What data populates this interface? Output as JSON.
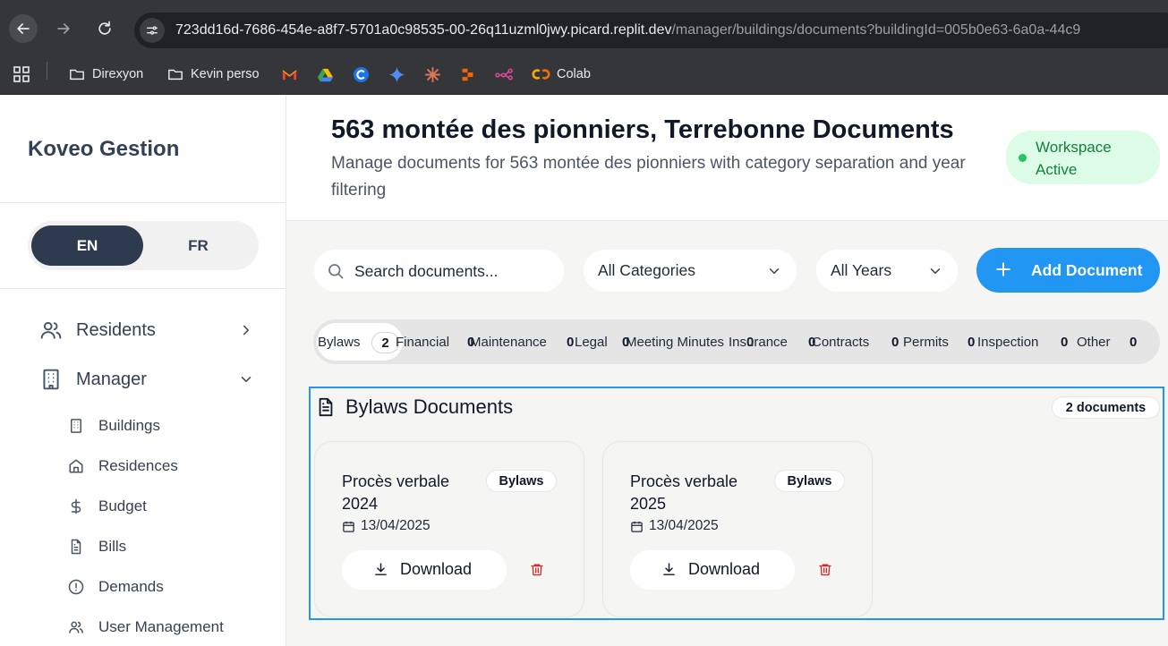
{
  "browser": {
    "url_main": "723dd16d-7686-454e-a8f7-5701a0c98535-00-26q11uzml0jwy.picard.replit.dev",
    "url_path": "/manager/buildings/documents?buildingId=005b0e63-6a0a-44c9",
    "bookmarks": [
      {
        "label": "Direxyon",
        "icon": "folder-icon"
      },
      {
        "label": "Kevin perso",
        "icon": "folder-icon"
      },
      {
        "label": "",
        "icon": "gmail-icon"
      },
      {
        "label": "",
        "icon": "drive-icon"
      },
      {
        "label": "",
        "icon": "c-icon"
      },
      {
        "label": "",
        "icon": "sparkle-icon"
      },
      {
        "label": "",
        "icon": "claude-icon"
      },
      {
        "label": "",
        "icon": "replit-icon"
      },
      {
        "label": "",
        "icon": "graph-icon"
      },
      {
        "label": "Colab",
        "icon": "colab-icon"
      }
    ]
  },
  "sidebar": {
    "brand": "Koveo Gestion",
    "lang": {
      "en": "EN",
      "fr": "FR",
      "active": "EN"
    },
    "menu": [
      {
        "label": "Residents",
        "icon": "users-icon",
        "expanded": false
      },
      {
        "label": "Manager",
        "icon": "building-icon",
        "expanded": true
      }
    ],
    "submenu": [
      {
        "label": "Buildings",
        "icon": "building-icon"
      },
      {
        "label": "Residences",
        "icon": "home-icon"
      },
      {
        "label": "Budget",
        "icon": "dollar-icon"
      },
      {
        "label": "Bills",
        "icon": "file-icon"
      },
      {
        "label": "Demands",
        "icon": "alert-circle-icon"
      },
      {
        "label": "User Management",
        "icon": "users-icon"
      }
    ]
  },
  "header": {
    "title": "563 montée des pionniers, Terrebonne Documents",
    "description": "Manage documents for 563 montée des pionniers with category separation and year filtering",
    "workspace_status": "Workspace Active",
    "status_color": "#22c55e"
  },
  "controls": {
    "search_placeholder": "Search documents...",
    "category_value": "All Categories",
    "year_value": "All Years",
    "add_button": "Add Document"
  },
  "tabs": [
    {
      "label": "Bylaws",
      "count": "2",
      "active": true
    },
    {
      "label": "Financial",
      "count": "0"
    },
    {
      "label": "Maintenance",
      "count": "0"
    },
    {
      "label": "Legal",
      "count": "0"
    },
    {
      "label": "Meeting Minutes",
      "count": "0"
    },
    {
      "label": "Insurance",
      "count": "0"
    },
    {
      "label": "Contracts",
      "count": "0"
    },
    {
      "label": "Permits",
      "count": "0"
    },
    {
      "label": "Inspection",
      "count": "0"
    },
    {
      "label": "Other",
      "count": "0"
    }
  ],
  "section": {
    "title": "Bylaws Documents",
    "count": "2 documents",
    "documents": [
      {
        "title": "Procès verbale 2024",
        "category": "Bylaws",
        "date": "13/04/2025",
        "download": "Download"
      },
      {
        "title": "Procès verbale 2025",
        "category": "Bylaws",
        "date": "13/04/2025",
        "download": "Download"
      }
    ]
  },
  "colors": {
    "accent": "#2196f3",
    "sidebar_active": "#2e3a4e",
    "danger": "#dc2626"
  }
}
